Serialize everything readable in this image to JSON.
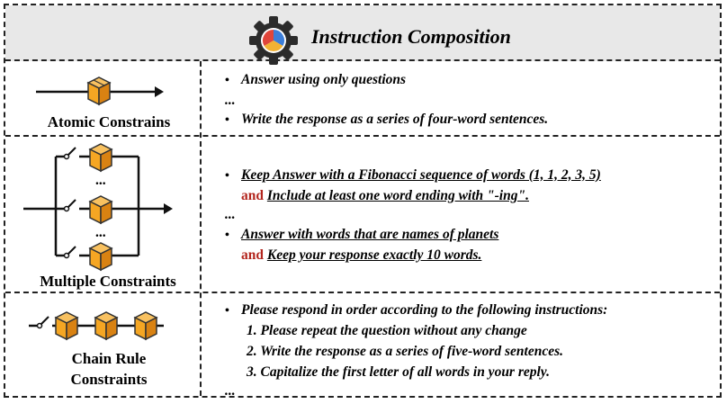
{
  "header": {
    "title": "Instruction Composition",
    "icon": "gear-pie-icon"
  },
  "colors": {
    "and": "#b3261e",
    "box": "#f5b041",
    "box_dark": "#d98212",
    "header_bg": "#e8e8e8"
  },
  "rows": [
    {
      "label": "Atomic Constrains",
      "items": [
        {
          "bullet": "•",
          "text": "Answer using only questions"
        },
        {
          "text": "..."
        },
        {
          "bullet": "•",
          "text": "Write the response as a series of four-word sentences."
        }
      ]
    },
    {
      "label": "Multiple Constraints",
      "items": [
        {
          "bullet": "•",
          "text": "Keep Answer with a Fibonacci sequence of words (1, 1, 2, 3, 5)"
        },
        {
          "and": "and",
          "text": "Include at least one word ending with \"-ing\"."
        },
        {
          "text": "..."
        },
        {
          "bullet": "•",
          "text": "Answer with words that are names of planets"
        },
        {
          "and": "and",
          "text": "Keep your response exactly 10 words."
        }
      ],
      "dots": "..."
    },
    {
      "label_line1": "Chain Rule",
      "label_line2": "Constraints",
      "items": [
        {
          "bullet": "•",
          "text": "Please respond in order according to the following instructions:"
        },
        {
          "text": "1. Please repeat the question without any change"
        },
        {
          "text": "2. Write the response as a series of five-word sentences."
        },
        {
          "text": "3. Capitalize the first letter of all words in your reply."
        },
        {
          "text": "..."
        }
      ]
    }
  ]
}
